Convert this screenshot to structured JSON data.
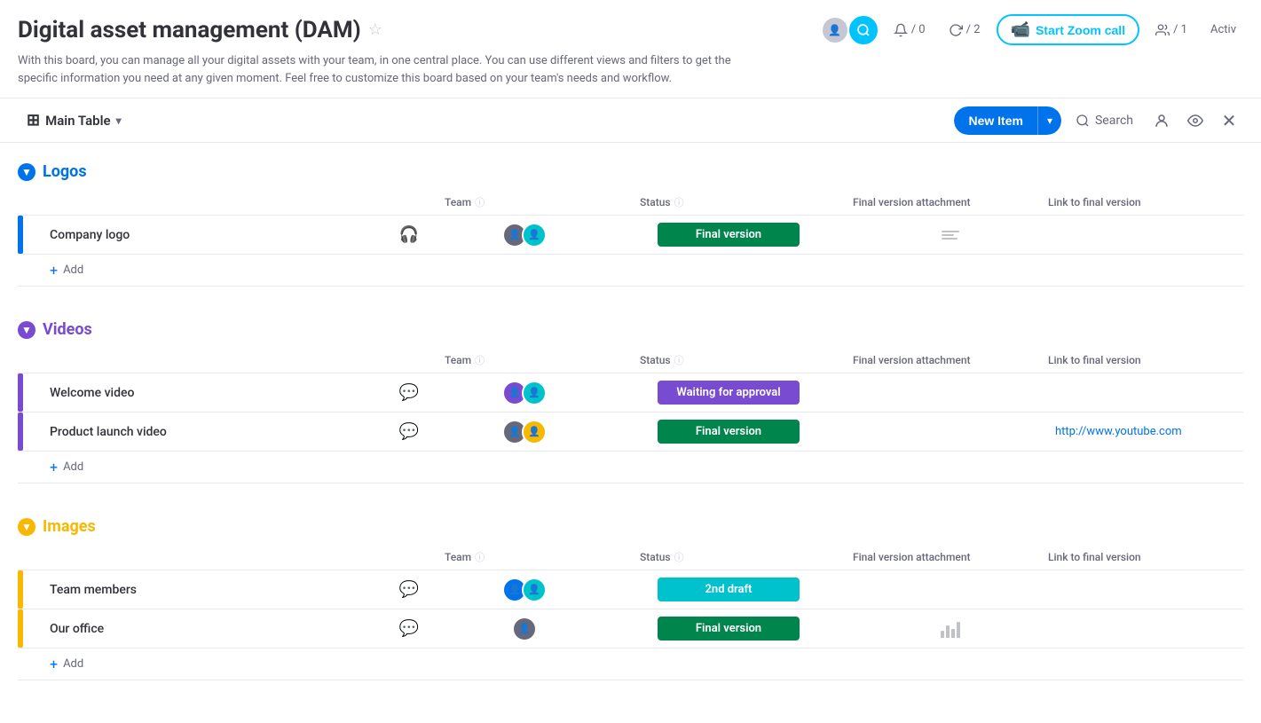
{
  "header": {
    "title": "Digital asset management (DAM)",
    "description": "With this board, you can manage all your digital assets with your team, in one central place. You can use different views and filters to get the specific information you need at any given moment. Feel free to customize this board based on your team's needs and workflow.",
    "zoom_btn_label": "Start Zoom call",
    "stat_notifications": "/ 0",
    "stat_updates": "/ 2",
    "stat_people": "/ 1",
    "activity_label": "Activ"
  },
  "toolbar": {
    "table_name": "Main Table",
    "new_item_label": "New Item",
    "search_label": "Search"
  },
  "groups": [
    {
      "id": "logos",
      "title": "Logos",
      "color": "#0073ea",
      "columns": [
        "Team",
        "Status",
        "Final version attachment",
        "Link to final version"
      ],
      "rows": [
        {
          "name": "Company logo",
          "has_audio": true,
          "team": [
            "av-blue",
            "av-teal"
          ],
          "status": "Final version",
          "status_class": "status-final",
          "has_attachment": true,
          "link": ""
        }
      ],
      "add_label": "+ Add"
    },
    {
      "id": "videos",
      "title": "Videos",
      "color": "#784bd1",
      "columns": [
        "Team",
        "Status",
        "Final version attachment",
        "Link to final version"
      ],
      "rows": [
        {
          "name": "Welcome video",
          "has_audio": false,
          "team": [
            "av-purple",
            "av-teal"
          ],
          "status": "Waiting for approval",
          "status_class": "status-waiting",
          "has_attachment": false,
          "link": ""
        },
        {
          "name": "Product launch video",
          "has_audio": false,
          "team": [
            "av-gray",
            "av-yellow"
          ],
          "status": "Final version",
          "status_class": "status-final",
          "has_attachment": false,
          "link": "http://www.youtube.com"
        }
      ],
      "add_label": "+ Add"
    },
    {
      "id": "images",
      "title": "Images",
      "color": "#f9b800",
      "columns": [
        "Team",
        "Status",
        "Final version attachment",
        "Link to final version"
      ],
      "rows": [
        {
          "name": "Team members",
          "has_audio": false,
          "team": [
            "av-blue",
            "av-teal"
          ],
          "status": "2nd draft",
          "status_class": "status-draft",
          "has_attachment": false,
          "link": ""
        },
        {
          "name": "Our office",
          "has_audio": false,
          "team": [
            "av-gray"
          ],
          "status": "Final version",
          "status_class": "status-final",
          "has_attachment": true,
          "link": ""
        }
      ],
      "add_label": "+ Add"
    }
  ]
}
